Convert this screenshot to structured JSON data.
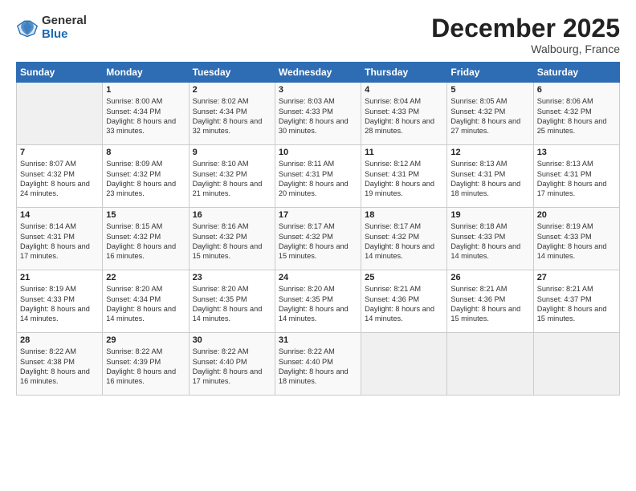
{
  "logo": {
    "general": "General",
    "blue": "Blue"
  },
  "header": {
    "month": "December 2025",
    "location": "Walbourg, France"
  },
  "weekdays": [
    "Sunday",
    "Monday",
    "Tuesday",
    "Wednesday",
    "Thursday",
    "Friday",
    "Saturday"
  ],
  "weeks": [
    [
      {
        "day": "",
        "sunrise": "",
        "sunset": "",
        "daylight": ""
      },
      {
        "day": "1",
        "sunrise": "Sunrise: 8:00 AM",
        "sunset": "Sunset: 4:34 PM",
        "daylight": "Daylight: 8 hours and 33 minutes."
      },
      {
        "day": "2",
        "sunrise": "Sunrise: 8:02 AM",
        "sunset": "Sunset: 4:34 PM",
        "daylight": "Daylight: 8 hours and 32 minutes."
      },
      {
        "day": "3",
        "sunrise": "Sunrise: 8:03 AM",
        "sunset": "Sunset: 4:33 PM",
        "daylight": "Daylight: 8 hours and 30 minutes."
      },
      {
        "day": "4",
        "sunrise": "Sunrise: 8:04 AM",
        "sunset": "Sunset: 4:33 PM",
        "daylight": "Daylight: 8 hours and 28 minutes."
      },
      {
        "day": "5",
        "sunrise": "Sunrise: 8:05 AM",
        "sunset": "Sunset: 4:32 PM",
        "daylight": "Daylight: 8 hours and 27 minutes."
      },
      {
        "day": "6",
        "sunrise": "Sunrise: 8:06 AM",
        "sunset": "Sunset: 4:32 PM",
        "daylight": "Daylight: 8 hours and 25 minutes."
      }
    ],
    [
      {
        "day": "7",
        "sunrise": "Sunrise: 8:07 AM",
        "sunset": "Sunset: 4:32 PM",
        "daylight": "Daylight: 8 hours and 24 minutes."
      },
      {
        "day": "8",
        "sunrise": "Sunrise: 8:09 AM",
        "sunset": "Sunset: 4:32 PM",
        "daylight": "Daylight: 8 hours and 23 minutes."
      },
      {
        "day": "9",
        "sunrise": "Sunrise: 8:10 AM",
        "sunset": "Sunset: 4:32 PM",
        "daylight": "Daylight: 8 hours and 21 minutes."
      },
      {
        "day": "10",
        "sunrise": "Sunrise: 8:11 AM",
        "sunset": "Sunset: 4:31 PM",
        "daylight": "Daylight: 8 hours and 20 minutes."
      },
      {
        "day": "11",
        "sunrise": "Sunrise: 8:12 AM",
        "sunset": "Sunset: 4:31 PM",
        "daylight": "Daylight: 8 hours and 19 minutes."
      },
      {
        "day": "12",
        "sunrise": "Sunrise: 8:13 AM",
        "sunset": "Sunset: 4:31 PM",
        "daylight": "Daylight: 8 hours and 18 minutes."
      },
      {
        "day": "13",
        "sunrise": "Sunrise: 8:13 AM",
        "sunset": "Sunset: 4:31 PM",
        "daylight": "Daylight: 8 hours and 17 minutes."
      }
    ],
    [
      {
        "day": "14",
        "sunrise": "Sunrise: 8:14 AM",
        "sunset": "Sunset: 4:31 PM",
        "daylight": "Daylight: 8 hours and 17 minutes."
      },
      {
        "day": "15",
        "sunrise": "Sunrise: 8:15 AM",
        "sunset": "Sunset: 4:32 PM",
        "daylight": "Daylight: 8 hours and 16 minutes."
      },
      {
        "day": "16",
        "sunrise": "Sunrise: 8:16 AM",
        "sunset": "Sunset: 4:32 PM",
        "daylight": "Daylight: 8 hours and 15 minutes."
      },
      {
        "day": "17",
        "sunrise": "Sunrise: 8:17 AM",
        "sunset": "Sunset: 4:32 PM",
        "daylight": "Daylight: 8 hours and 15 minutes."
      },
      {
        "day": "18",
        "sunrise": "Sunrise: 8:17 AM",
        "sunset": "Sunset: 4:32 PM",
        "daylight": "Daylight: 8 hours and 14 minutes."
      },
      {
        "day": "19",
        "sunrise": "Sunrise: 8:18 AM",
        "sunset": "Sunset: 4:33 PM",
        "daylight": "Daylight: 8 hours and 14 minutes."
      },
      {
        "day": "20",
        "sunrise": "Sunrise: 8:19 AM",
        "sunset": "Sunset: 4:33 PM",
        "daylight": "Daylight: 8 hours and 14 minutes."
      }
    ],
    [
      {
        "day": "21",
        "sunrise": "Sunrise: 8:19 AM",
        "sunset": "Sunset: 4:33 PM",
        "daylight": "Daylight: 8 hours and 14 minutes."
      },
      {
        "day": "22",
        "sunrise": "Sunrise: 8:20 AM",
        "sunset": "Sunset: 4:34 PM",
        "daylight": "Daylight: 8 hours and 14 minutes."
      },
      {
        "day": "23",
        "sunrise": "Sunrise: 8:20 AM",
        "sunset": "Sunset: 4:35 PM",
        "daylight": "Daylight: 8 hours and 14 minutes."
      },
      {
        "day": "24",
        "sunrise": "Sunrise: 8:20 AM",
        "sunset": "Sunset: 4:35 PM",
        "daylight": "Daylight: 8 hours and 14 minutes."
      },
      {
        "day": "25",
        "sunrise": "Sunrise: 8:21 AM",
        "sunset": "Sunset: 4:36 PM",
        "daylight": "Daylight: 8 hours and 14 minutes."
      },
      {
        "day": "26",
        "sunrise": "Sunrise: 8:21 AM",
        "sunset": "Sunset: 4:36 PM",
        "daylight": "Daylight: 8 hours and 15 minutes."
      },
      {
        "day": "27",
        "sunrise": "Sunrise: 8:21 AM",
        "sunset": "Sunset: 4:37 PM",
        "daylight": "Daylight: 8 hours and 15 minutes."
      }
    ],
    [
      {
        "day": "28",
        "sunrise": "Sunrise: 8:22 AM",
        "sunset": "Sunset: 4:38 PM",
        "daylight": "Daylight: 8 hours and 16 minutes."
      },
      {
        "day": "29",
        "sunrise": "Sunrise: 8:22 AM",
        "sunset": "Sunset: 4:39 PM",
        "daylight": "Daylight: 8 hours and 16 minutes."
      },
      {
        "day": "30",
        "sunrise": "Sunrise: 8:22 AM",
        "sunset": "Sunset: 4:40 PM",
        "daylight": "Daylight: 8 hours and 17 minutes."
      },
      {
        "day": "31",
        "sunrise": "Sunrise: 8:22 AM",
        "sunset": "Sunset: 4:40 PM",
        "daylight": "Daylight: 8 hours and 18 minutes."
      },
      {
        "day": "",
        "sunrise": "",
        "sunset": "",
        "daylight": ""
      },
      {
        "day": "",
        "sunrise": "",
        "sunset": "",
        "daylight": ""
      },
      {
        "day": "",
        "sunrise": "",
        "sunset": "",
        "daylight": ""
      }
    ]
  ]
}
